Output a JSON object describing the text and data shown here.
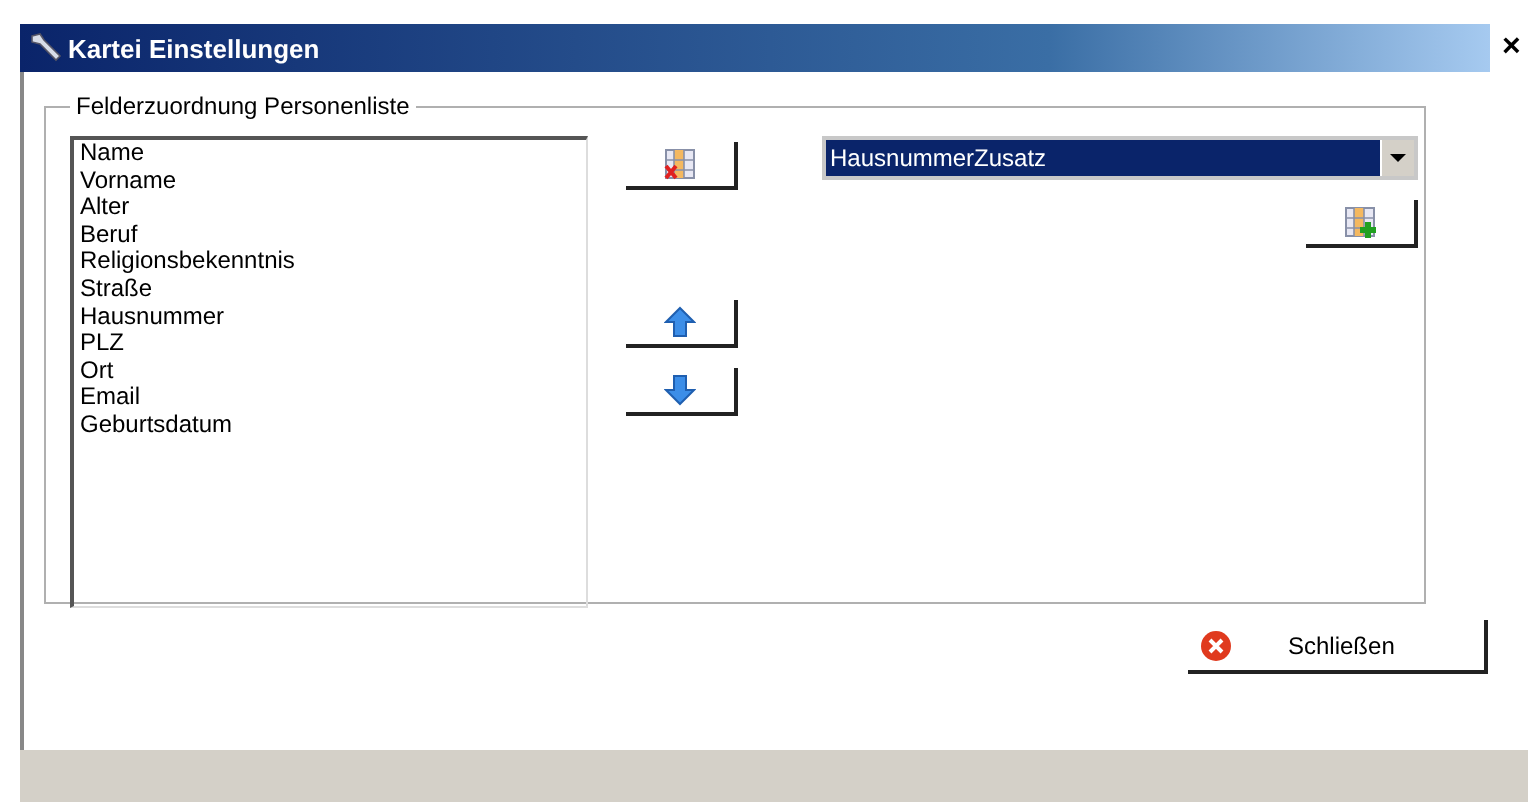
{
  "window": {
    "title": "Kartei Einstellungen",
    "close": "×"
  },
  "group": {
    "legend": "Felderzuordnung Personenliste",
    "fields": [
      "Name",
      "Vorname",
      "Alter",
      "Beruf",
      "Religionsbekenntnis",
      "Straße",
      "Hausnummer",
      "PLZ",
      "Ort",
      "Email",
      "Geburtsdatum"
    ],
    "combo": {
      "value": "HausnummerZusatz"
    }
  },
  "close_button": {
    "label": "Schließen"
  }
}
